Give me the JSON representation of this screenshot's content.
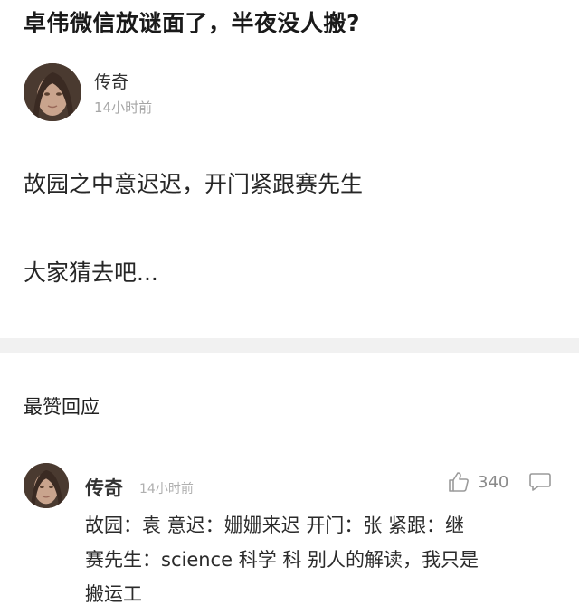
{
  "post": {
    "title": "卓伟微信放谜面了，半夜没人搬?",
    "author": "传奇",
    "time": "14小时前",
    "body_lines": [
      "故园之中意迟迟，开门紧跟赛先生",
      "大家猜去吧..."
    ]
  },
  "top_replies": {
    "heading": "最赞回应",
    "comments": [
      {
        "author": "传奇",
        "time": "14小时前",
        "likes": "340",
        "text_lines": [
          "故园：袁 意迟：姗姗来迟 开门：张 紧跟：继",
          "赛先生：science 科学 科 别人的解读，我只是",
          "搬运工"
        ]
      }
    ]
  },
  "icons": {
    "author_avatar": "avatar-photo",
    "like": "thumbs-up-icon",
    "reply": "speech-bubble-icon"
  },
  "colors": {
    "divider": "#f1f1f1",
    "muted_text": "#a6a6a6",
    "icon_gray": "#9a9a9a"
  }
}
